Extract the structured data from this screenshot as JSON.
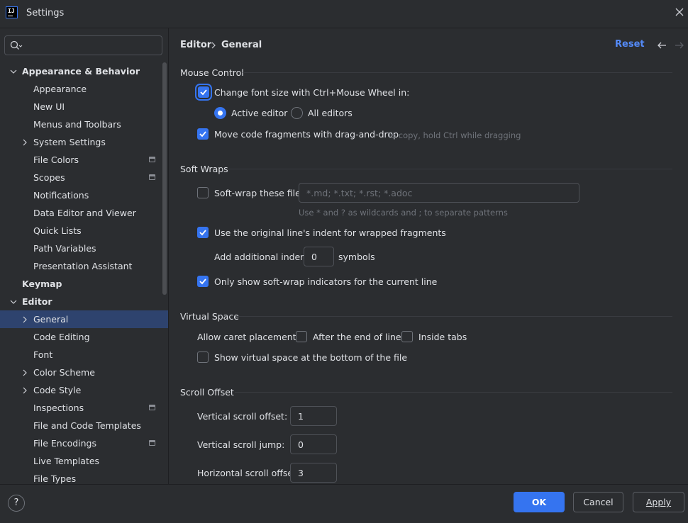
{
  "window": {
    "title": "Settings",
    "app_icon_text": "IJ"
  },
  "search": {
    "placeholder": "",
    "value": ""
  },
  "sidebar": {
    "items": [
      {
        "label": "Appearance & Behavior",
        "level": 0,
        "expanded": true,
        "bold": true
      },
      {
        "label": "Appearance",
        "level": 1
      },
      {
        "label": "New UI",
        "level": 1
      },
      {
        "label": "Menus and Toolbars",
        "level": 1
      },
      {
        "label": "System Settings",
        "level": 1,
        "collapsed": true
      },
      {
        "label": "File Colors",
        "level": 1,
        "project_icon": true
      },
      {
        "label": "Scopes",
        "level": 1,
        "project_icon": true
      },
      {
        "label": "Notifications",
        "level": 1
      },
      {
        "label": "Data Editor and Viewer",
        "level": 1
      },
      {
        "label": "Quick Lists",
        "level": 1
      },
      {
        "label": "Path Variables",
        "level": 1
      },
      {
        "label": "Presentation Assistant",
        "level": 1
      },
      {
        "label": "Keymap",
        "level": 0,
        "bold": true
      },
      {
        "label": "Editor",
        "level": 0,
        "expanded": true,
        "bold": true
      },
      {
        "label": "General",
        "level": 1,
        "collapsed": true,
        "selected": true
      },
      {
        "label": "Code Editing",
        "level": 1
      },
      {
        "label": "Font",
        "level": 1
      },
      {
        "label": "Color Scheme",
        "level": 1,
        "collapsed": true
      },
      {
        "label": "Code Style",
        "level": 1,
        "collapsed": true
      },
      {
        "label": "Inspections",
        "level": 1,
        "project_icon": true
      },
      {
        "label": "File and Code Templates",
        "level": 1
      },
      {
        "label": "File Encodings",
        "level": 1,
        "project_icon": true
      },
      {
        "label": "Live Templates",
        "level": 1
      },
      {
        "label": "File Types",
        "level": 1
      }
    ]
  },
  "header": {
    "breadcrumb": [
      "Editor",
      "General"
    ],
    "reset_label": "Reset"
  },
  "mouse_control": {
    "title": "Mouse Control",
    "change_font_label": "Change font size with Ctrl+Mouse Wheel in:",
    "change_font_checked": true,
    "active_editor_label": "Active editor",
    "all_editors_label": "All editors",
    "selected_scope": "Active editor",
    "drag_drop_label": "Move code fragments with drag-and-drop",
    "drag_drop_checked": true,
    "drag_drop_hint": "To copy, hold Ctrl while dragging"
  },
  "soft_wraps": {
    "title": "Soft Wraps",
    "soft_wrap_files_label": "Soft-wrap these files:",
    "soft_wrap_files_checked": false,
    "patterns_placeholder": "*.md; *.txt; *.rst; *.adoc",
    "patterns_hint": "Use * and ? as wildcards and ; to separate patterns",
    "original_indent_label": "Use the original line's indent for wrapped fragments",
    "original_indent_checked": true,
    "additional_indent_label": "Add additional indent:",
    "additional_indent_value": "0",
    "symbols_label": "symbols",
    "only_current_line_label": "Only show soft-wrap indicators for the current line",
    "only_current_line_checked": true
  },
  "virtual_space": {
    "title": "Virtual Space",
    "caret_placement_label": "Allow caret placement:",
    "after_end_label": "After the end of line",
    "after_end_checked": false,
    "inside_tabs_label": "Inside tabs",
    "inside_tabs_checked": false,
    "show_bottom_label": "Show virtual space at the bottom of the file",
    "show_bottom_checked": false
  },
  "scroll_offset": {
    "title": "Scroll Offset",
    "vertical_offset_label": "Vertical scroll offset:",
    "vertical_offset_value": "1",
    "vertical_jump_label": "Vertical scroll jump:",
    "vertical_jump_value": "0",
    "horizontal_offset_label": "Horizontal scroll offset:",
    "horizontal_offset_value": "3"
  },
  "footer": {
    "help_label": "?",
    "ok_label": "OK",
    "cancel_label": "Cancel",
    "apply_label": "Apply"
  },
  "colors": {
    "background": "#2b2d30",
    "accent": "#3574f0",
    "selection": "#2e436e",
    "link": "#548af7",
    "hint": "#6f737a"
  }
}
